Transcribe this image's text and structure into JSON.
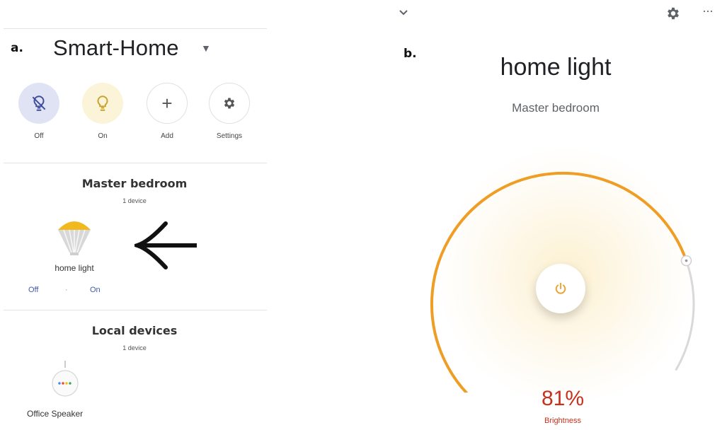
{
  "panels": {
    "a": "a.",
    "b": "b."
  },
  "home": {
    "title": "Smart-Home",
    "quick_actions": [
      {
        "label": "Off",
        "icon": "light-off-icon",
        "bg": "#dfe3f3",
        "fg": "#3d4d9c"
      },
      {
        "label": "On",
        "icon": "lightbulb-icon",
        "bg": "#fbf4d9",
        "fg": "#c9a22b"
      },
      {
        "label": "Add",
        "icon": "plus-icon",
        "bg": "#ffffff",
        "fg": "#555555"
      },
      {
        "label": "Settings",
        "icon": "gear-icon",
        "bg": "#ffffff",
        "fg": "#555555"
      }
    ],
    "rooms": [
      {
        "name": "Master bedroom",
        "count": "1 device",
        "device": {
          "name": "home light",
          "off": "Off",
          "sep": "·",
          "on": "On"
        }
      },
      {
        "name": "Local devices",
        "count": "1 device",
        "device": {
          "name": "Office Speaker"
        }
      }
    ]
  },
  "device_page": {
    "title": "home light",
    "room": "Master bedroom",
    "brightness_value": "81%",
    "brightness_label": "Brightness",
    "brightness_fraction": 0.81,
    "accent": "#ef9d24"
  }
}
